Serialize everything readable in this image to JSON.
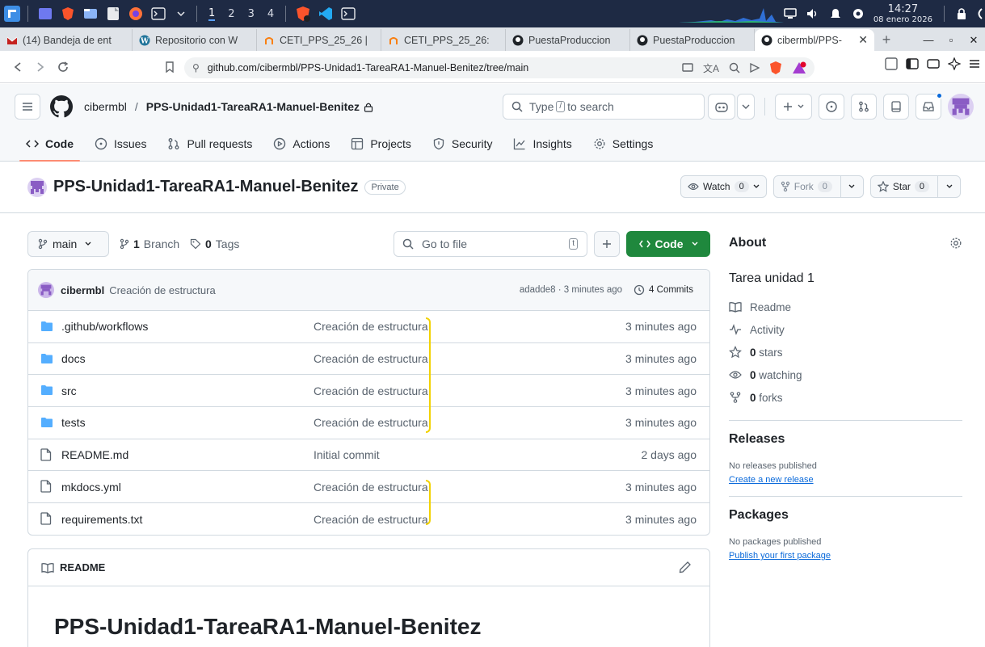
{
  "os": {
    "workspaces": [
      "1",
      "2",
      "3",
      "4"
    ],
    "clock_time": "14:27",
    "clock_date": "08 enero 2026"
  },
  "browser": {
    "tabs": [
      {
        "label": "(14) Bandeja de ent",
        "icon": "mail-icon"
      },
      {
        "label": "Repositorio con W",
        "icon": "wordpress-icon"
      },
      {
        "label": "CETI_PPS_25_26 |",
        "icon": "moodle-icon"
      },
      {
        "label": "CETI_PPS_25_26:",
        "icon": "moodle-icon"
      },
      {
        "label": "PuestaProduccion",
        "icon": "github-icon"
      },
      {
        "label": "PuestaProduccion",
        "icon": "github-icon"
      }
    ],
    "active_tab": "cibermbl/PPS-",
    "url": "github.com/cibermbl/PPS-Unidad1-TareaRA1-Manuel-Benitez/tree/main"
  },
  "gh": {
    "owner": "cibermbl",
    "separator": "/",
    "repo": "PPS-Unidad1-TareaRA1-Manuel-Benitez",
    "search_prefix": "Type",
    "search_key": "/",
    "search_suffix": "to search",
    "nav": [
      {
        "label": "Code"
      },
      {
        "label": "Issues"
      },
      {
        "label": "Pull requests"
      },
      {
        "label": "Actions"
      },
      {
        "label": "Projects"
      },
      {
        "label": "Security"
      },
      {
        "label": "Insights"
      },
      {
        "label": "Settings"
      }
    ],
    "visibility": "Private",
    "watch_label": "Watch",
    "watch_count": "0",
    "fork_label": "Fork",
    "fork_count": "0",
    "star_label": "Star",
    "star_count": "0",
    "branch": "main",
    "branch_count": "1",
    "branch_label": "Branch",
    "tag_count": "0",
    "tag_label": "Tags",
    "go_to_file": "Go to file",
    "go_to_file_key": "t",
    "code_button": "Code",
    "commit": {
      "user": "cibermbl",
      "message": "Creación de estructura",
      "meta": "adadde8 · 3 minutes ago",
      "commits": "4 Commits"
    },
    "files": [
      {
        "name": ".github/workflows",
        "type": "folder",
        "message": "Creación de estructura",
        "time": "3 minutes ago"
      },
      {
        "name": "docs",
        "type": "folder",
        "message": "Creación de estructura",
        "time": "3 minutes ago"
      },
      {
        "name": "src",
        "type": "folder",
        "message": "Creación de estructura",
        "time": "3 minutes ago"
      },
      {
        "name": "tests",
        "type": "folder",
        "message": "Creación de estructura",
        "time": "3 minutes ago"
      },
      {
        "name": "README.md",
        "type": "file",
        "message": "Initial commit",
        "time": "2 days ago"
      },
      {
        "name": "mkdocs.yml",
        "type": "file",
        "message": "Creación de estructura",
        "time": "3 minutes ago"
      },
      {
        "name": "requirements.txt",
        "type": "file",
        "message": "Creación de estructura",
        "time": "3 minutes ago"
      }
    ],
    "readme_label": "README",
    "readme_heading": "PPS-Unidad1-TareaRA1-Manuel-Benitez"
  },
  "sidebar": {
    "about_title": "About",
    "description": "Tarea unidad 1",
    "readme": "Readme",
    "activity": "Activity",
    "stars_count": "0",
    "stars_label": "stars",
    "watching_count": "0",
    "watching_label": "watching",
    "forks_count": "0",
    "forks_label": "forks",
    "releases_title": "Releases",
    "releases_none": "No releases published",
    "releases_link": "Create a new release",
    "packages_title": "Packages",
    "packages_none": "No packages published",
    "packages_link": "Publish your first package"
  },
  "colors": {
    "accent_green": "#1f883d",
    "nav_underline": "#fd8c73",
    "folder": "#54aeff",
    "highlight_yellow": "#f2d200",
    "link": "#0969da"
  }
}
